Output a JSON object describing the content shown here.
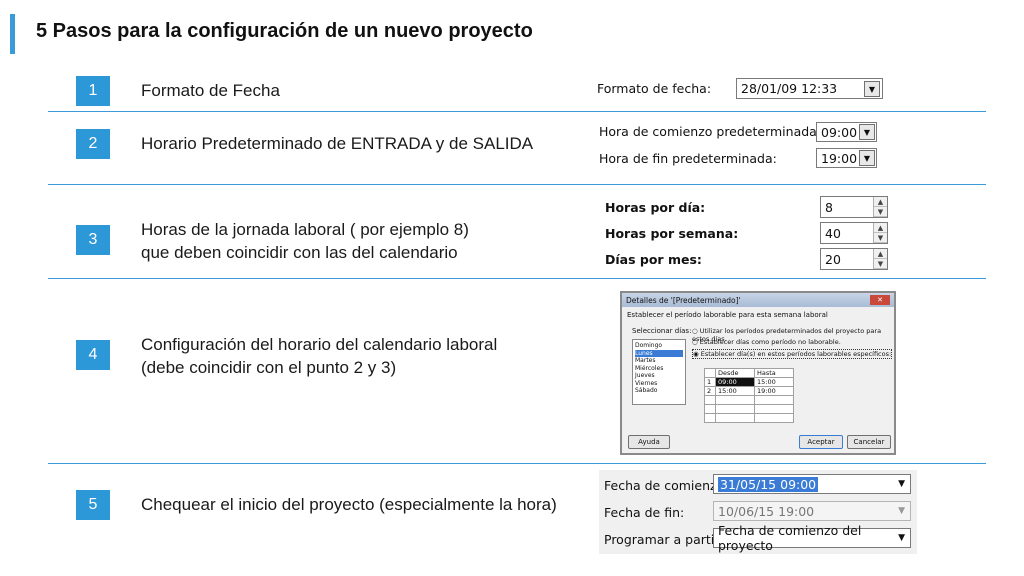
{
  "page": {
    "title": "5 Pasos para la configuración de un nuevo proyecto"
  },
  "steps": [
    {
      "number": "1",
      "text": "Formato de Fecha"
    },
    {
      "number": "2",
      "text": "Horario Predeterminado de ENTRADA y de SALIDA"
    },
    {
      "number": "3",
      "line1": "Horas de la jornada laboral ( por ejemplo 8)",
      "line2": "que deben coincidir con las del calendario"
    },
    {
      "number": "4",
      "line1": "Configuración del horario del calendario laboral",
      "line2": "(debe coincidir con el punto 2 y 3)"
    },
    {
      "number": "5",
      "text": "Chequear el inicio del proyecto (especialmente la hora)"
    }
  ],
  "step1_ui": {
    "label": "Formato de fecha:",
    "value": "28/01/09 12:33"
  },
  "step2_ui": {
    "start_label": "Hora de comienzo predeterminada:",
    "start_value": "09:00",
    "end_label": "Hora de fin predeterminada:",
    "end_value": "19:00"
  },
  "step3_ui": {
    "hours_day_label": "Horas por día:",
    "hours_day_value": "8",
    "hours_week_label": "Horas por semana:",
    "hours_week_value": "40",
    "days_month_label": "Días por mes:",
    "days_month_value": "20"
  },
  "step4_ui": {
    "title": "Detalles de '[Predeterminado]'",
    "subtitle": "Establecer el período laborable para esta semana laboral",
    "select_days_label": "Seleccionar días:",
    "days": [
      "Domingo",
      "Lunes",
      "Martes",
      "Miércoles",
      "Jueves",
      "Viernes",
      "Sábado"
    ],
    "options": [
      "Utilizar los períodos predeterminados del proyecto para estos días.",
      "Establecer días como período no laborable.",
      "Establecer día(s) en estos períodos laborables específicos:"
    ],
    "table_headers": [
      "Desde",
      "Hasta"
    ],
    "rows": [
      {
        "n": "1",
        "from": "09:00",
        "to": "15:00"
      },
      {
        "n": "2",
        "from": "15:00",
        "to": "19:00"
      }
    ],
    "help_label": "Ayuda",
    "ok_label": "Aceptar",
    "cancel_label": "Cancelar"
  },
  "step5_ui": {
    "start_label": "Fecha de comienzo:",
    "start_value": "31/05/15 09:00",
    "end_label": "Fecha de fin:",
    "end_value": "10/06/15 19:00",
    "schedule_label": "Programar a partir de:",
    "schedule_value": "Fecha de comienzo del proyecto"
  },
  "colors": {
    "accent": "#2d98d8",
    "separator": "#3b9ad9"
  }
}
